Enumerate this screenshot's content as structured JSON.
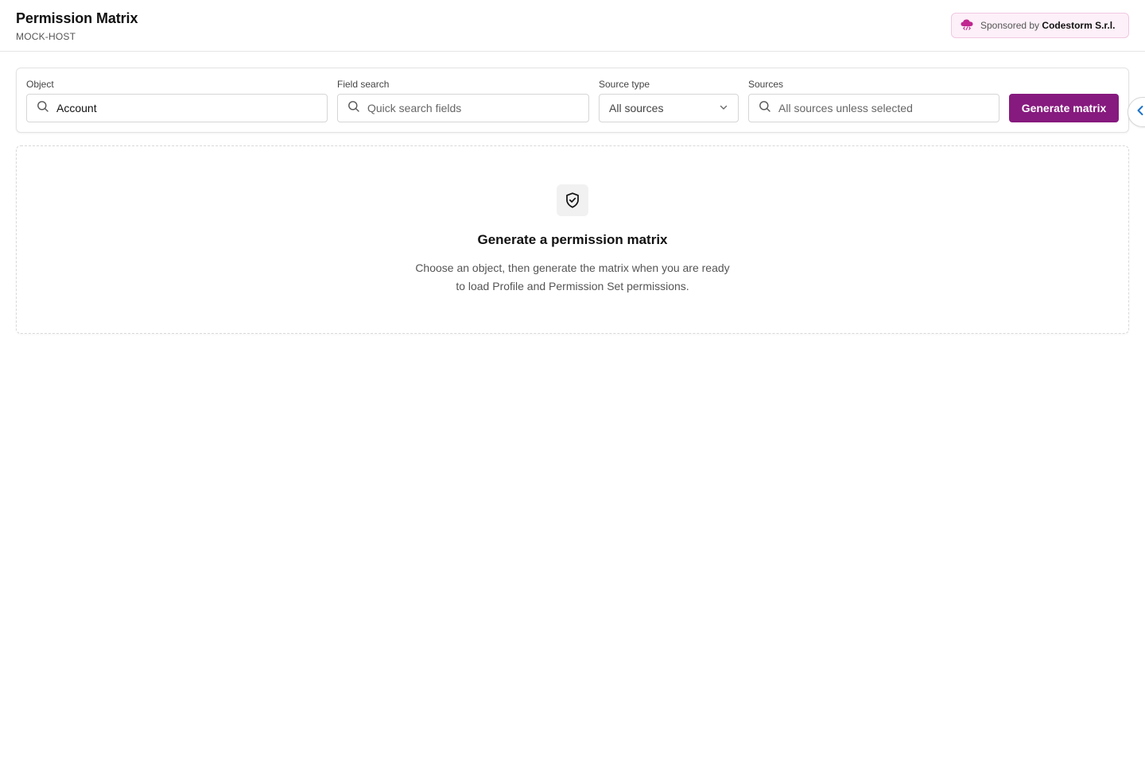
{
  "header": {
    "title": "Permission Matrix",
    "host": "MOCK-HOST",
    "sponsor": {
      "prefix": "Sponsored by",
      "name": "Codestorm S.r.l.",
      "icon": "cloud-code-icon",
      "color": "#c0268f"
    }
  },
  "toolbar": {
    "object": {
      "label": "Object",
      "value": "Account",
      "icon": "search-icon"
    },
    "field_search": {
      "label": "Field search",
      "placeholder": "Quick search fields",
      "icon": "search-icon"
    },
    "source_type": {
      "label": "Source type",
      "selected": "All sources",
      "icon": "chevron-down-icon"
    },
    "sources": {
      "label": "Sources",
      "placeholder": "All sources unless selected",
      "icon": "search-icon"
    },
    "generate_label": "Generate matrix",
    "accent": "#861a7e"
  },
  "side_toggle": {
    "icon": "chevron-left-icon",
    "color": "#1b73c9"
  },
  "empty_state": {
    "icon": "shield-check-icon",
    "title": "Generate a permission matrix",
    "description": "Choose an object, then generate the matrix when you are ready to load Profile and Permission Set permissions."
  }
}
